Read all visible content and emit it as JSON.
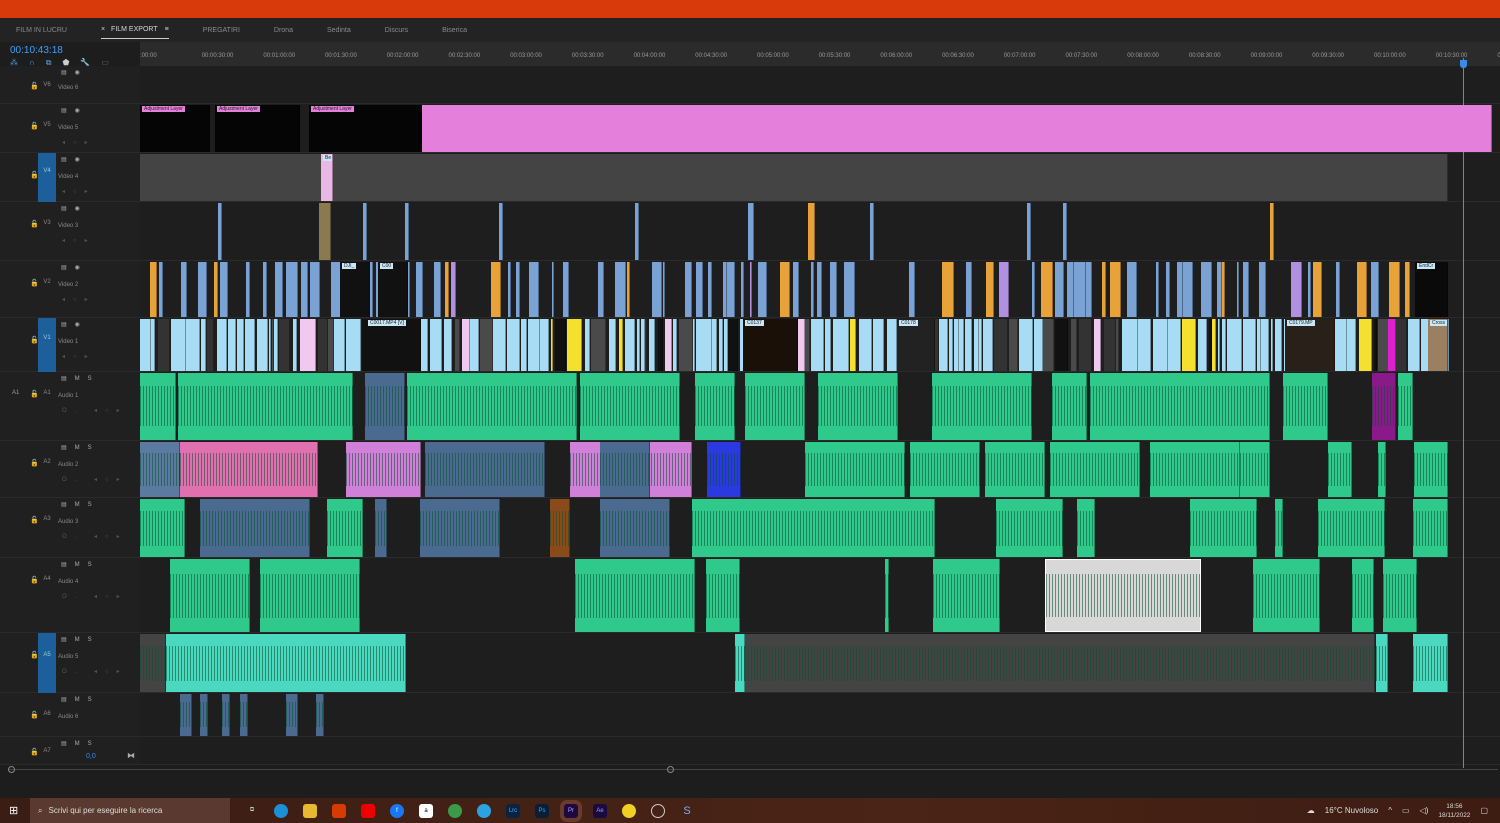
{
  "tabs": [
    {
      "label": "FILM  IN LUCRU",
      "active": false
    },
    {
      "label": "FILM  EXPORT",
      "active": true
    },
    {
      "label": "PREGATIRI",
      "active": false
    },
    {
      "label": "Drona",
      "active": false
    },
    {
      "label": "Sedinta",
      "active": false
    },
    {
      "label": "Discurs",
      "active": false
    },
    {
      "label": "Biserica",
      "active": false
    }
  ],
  "close_glyph": "×",
  "menu_glyph": "≡",
  "timecode": "00:10:43:18",
  "ruler": [
    ":00:00",
    "00:00:30:00",
    "00:01:00:00",
    "00:01:30:00",
    "00:02:00:00",
    "00:02:30:00",
    "00:03:00:00",
    "00:03:30:00",
    "00:04:00:00",
    "00:04:30:00",
    "00:05:00:00",
    "00:05:30:00",
    "00:06:00:00",
    "00:06:30:00",
    "00:07:00:00",
    "00:07:30:00",
    "00:08:00:00",
    "00:08:30:00",
    "00:09:00:00",
    "00:09:30:00",
    "00:10:00:00",
    "00:10:30:00",
    "00:1"
  ],
  "tracks": [
    {
      "id": "V6",
      "name": "Video 6",
      "selected": false
    },
    {
      "id": "V5",
      "name": "Video 5",
      "selected": false
    },
    {
      "id": "V4",
      "name": "Video 4",
      "selected": true
    },
    {
      "id": "V3",
      "name": "Video 3",
      "selected": false
    },
    {
      "id": "V2",
      "name": "Video 2",
      "selected": false
    },
    {
      "id": "V1",
      "name": "Video 1",
      "selected": true
    },
    {
      "id": "A1",
      "name": "Audio 1",
      "selected": false,
      "source": "A1"
    },
    {
      "id": "A2",
      "name": "Audio 2",
      "selected": false
    },
    {
      "id": "A3",
      "name": "Audio 3",
      "selected": false
    },
    {
      "id": "A4",
      "name": "Audio 4",
      "selected": false
    },
    {
      "id": "A5",
      "name": "Audio 5",
      "selected": true
    },
    {
      "id": "A6",
      "name": "Audio 6",
      "selected": false
    },
    {
      "id": "A7",
      "name": "",
      "selected": false
    }
  ],
  "master_volume": "0,0",
  "clip_labels": {
    "adj": "Adjustment Layer",
    "dji": "DJI_",
    "c00": "C00",
    "c0017": "C0017.MP4 [V]",
    "c0137": "C0137",
    "c0178": "C0178",
    "c0179": "C0179.MP",
    "endcr": "EndCr",
    "cross": "Cross",
    "be": "Be"
  },
  "colors": {
    "accent": "#3a8ae8",
    "adjustment": "#e57fdc",
    "video_blue": "#7aa2d4",
    "video_light": "#a8dcf4",
    "orange": "#e8a23a",
    "audio_green": "#2fc98c",
    "audio_pink": "#e070b0"
  },
  "taskbar": {
    "search_placeholder": "Scrivi qui per eseguire la ricerca",
    "apps": [
      "Lrc",
      "Ps",
      "Pr",
      "Ae"
    ],
    "weather": "16°C  Nuvoloso",
    "time": "18:56",
    "date": "18/11/2022"
  }
}
